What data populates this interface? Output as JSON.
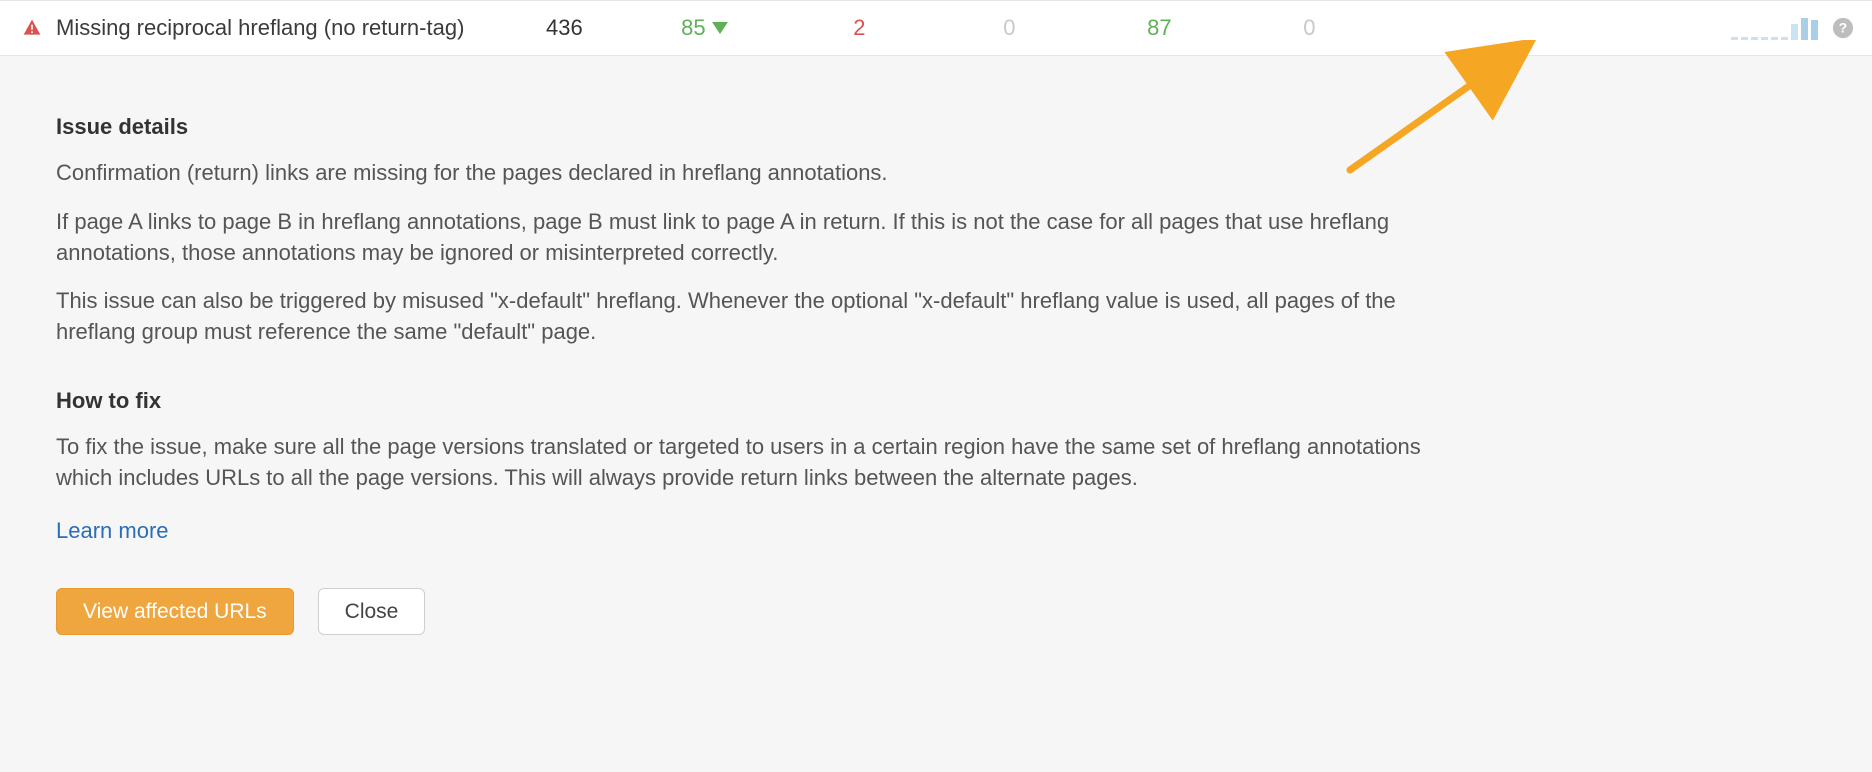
{
  "row": {
    "title": "Missing reciprocal hreflang (no return-tag)",
    "metrics": {
      "count": "436",
      "down_value": "85",
      "up_value": "2",
      "zero1": "0",
      "green2": "87",
      "zero2": "0"
    }
  },
  "details": {
    "heading": "Issue details",
    "p1": "Confirmation (return) links are missing for the pages declared in hreflang annotations.",
    "p2": "If page A links to page B in hreflang annotations, page B must link to page A in return. If this is not the case for all pages that use hreflang annotations, those annotations may be ignored or misinterpreted correctly.",
    "p3": "This issue can also be triggered by misused \"x-default\" hreflang. Whenever the optional \"x-default\" hreflang value is used, all pages of the hreflang group must reference the same \"default\" page.",
    "howto_heading": "How to fix",
    "howto_text": "To fix the issue, make sure all the page versions translated or targeted to users in a certain region have the same set of hreflang annotations which includes URLs to all the page versions. This will always provide return links between the alternate pages.",
    "learn_more": "Learn more"
  },
  "buttons": {
    "view": "View affected URLs",
    "close": "Close"
  },
  "chart_data": {
    "type": "bar",
    "note": "sparkline showing crawl trend; low values then spike",
    "values": [
      2,
      2,
      2,
      2,
      2,
      2,
      16,
      22,
      20
    ]
  }
}
